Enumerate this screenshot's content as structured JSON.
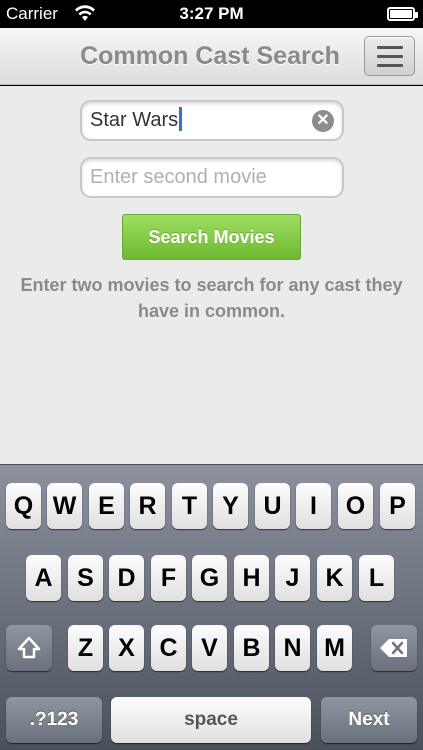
{
  "status_bar": {
    "carrier": "Carrier",
    "time": "3:27 PM"
  },
  "nav": {
    "title": "Common Cast Search",
    "menu_icon": "menu-icon"
  },
  "form": {
    "first_movie_value": "Star Wars",
    "second_movie_placeholder": "Enter second movie",
    "clear_icon": "clear-icon",
    "search_button": "Search Movies",
    "hint": "Enter two movies to search for any cast they have in common."
  },
  "keyboard": {
    "row1": [
      "Q",
      "W",
      "E",
      "R",
      "T",
      "Y",
      "U",
      "I",
      "O",
      "P"
    ],
    "row2": [
      "A",
      "S",
      "D",
      "F",
      "G",
      "H",
      "J",
      "K",
      "L"
    ],
    "row3": [
      "Z",
      "X",
      "C",
      "V",
      "B",
      "N",
      "M"
    ],
    "mode_key": ".?123",
    "space_key": "space",
    "return_key": "Next",
    "shift_icon": "shift-icon",
    "delete_icon": "backspace-icon"
  },
  "colors": {
    "accent_green": "#7fc63f",
    "title_gray": "#8a8a8a",
    "cursor_blue": "#3270d8"
  }
}
